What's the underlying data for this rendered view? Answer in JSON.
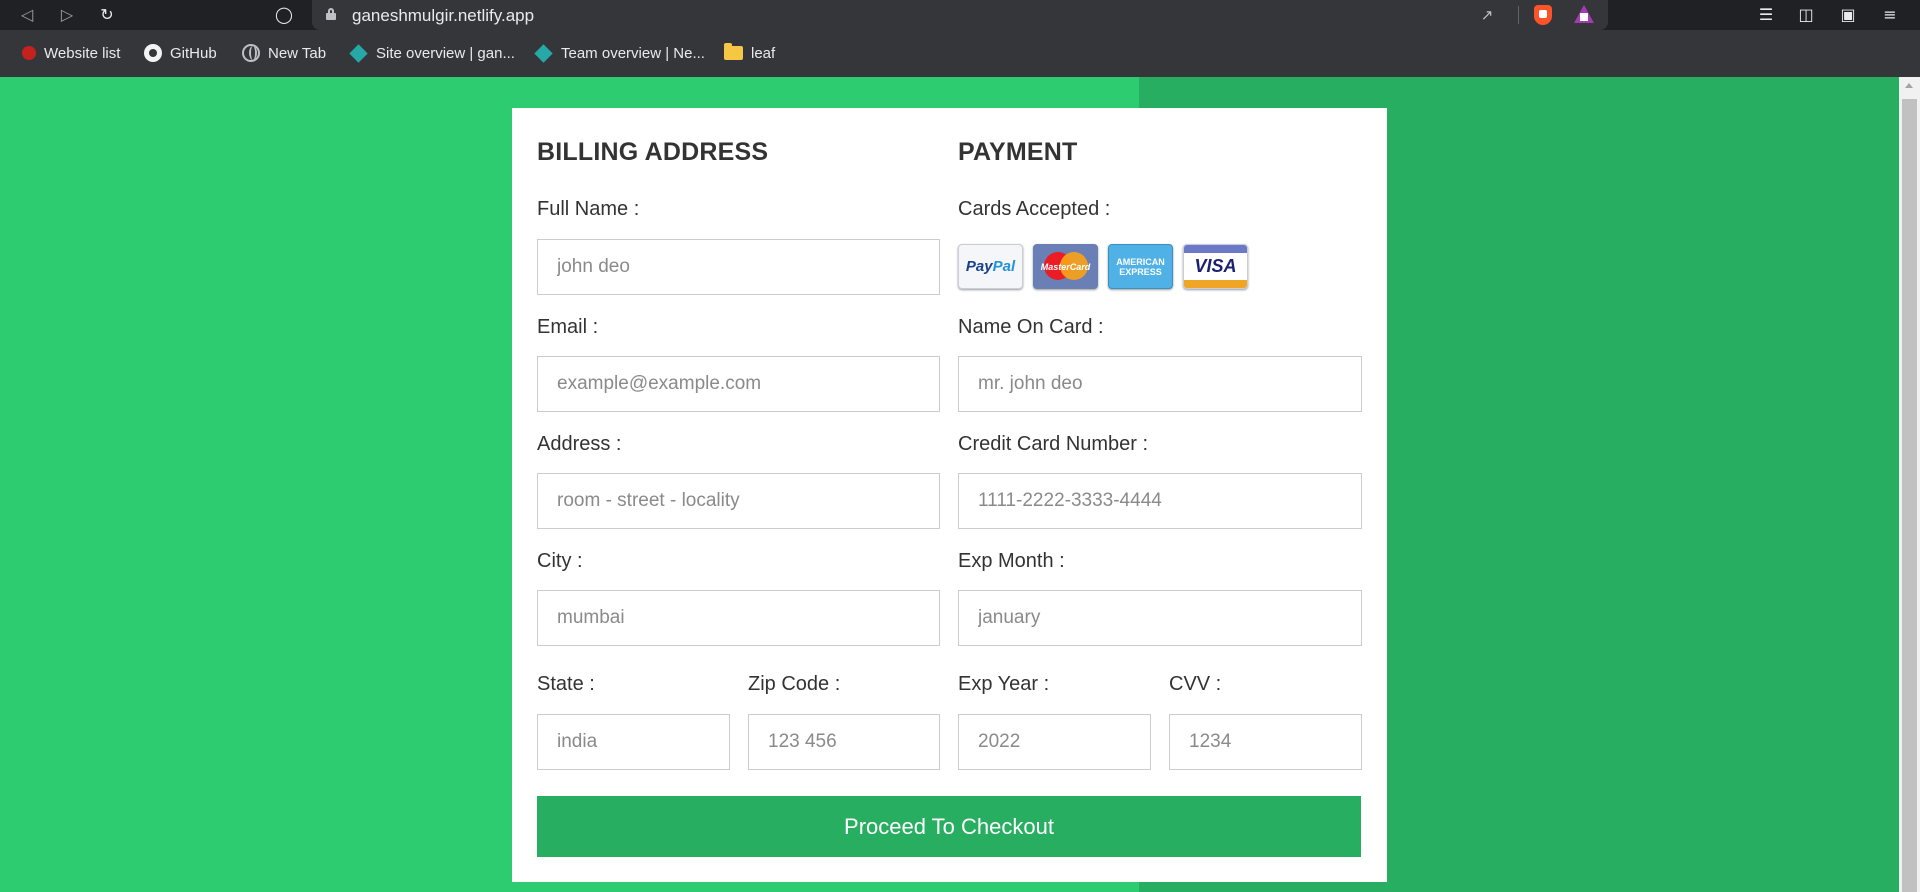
{
  "browser": {
    "url": "ganeshmulgir.netlify.app",
    "bookmarks": [
      {
        "label": "Website list",
        "icon": "red-circle-icon"
      },
      {
        "label": "GitHub",
        "icon": "github-icon"
      },
      {
        "label": "New Tab",
        "icon": "globe-icon"
      },
      {
        "label": "Site overview | gan...",
        "icon": "netlify-icon"
      },
      {
        "label": "Team overview | Ne...",
        "icon": "netlify-icon"
      },
      {
        "label": "leaf",
        "icon": "folder-icon"
      }
    ]
  },
  "billing": {
    "title": "BILLING ADDRESS",
    "full_name": {
      "label": "Full Name :",
      "placeholder": "john deo"
    },
    "email": {
      "label": "Email :",
      "placeholder": "example@example.com"
    },
    "address": {
      "label": "Address :",
      "placeholder": "room - street - locality"
    },
    "city": {
      "label": "City :",
      "placeholder": "mumbai"
    },
    "state": {
      "label": "State :",
      "placeholder": "india"
    },
    "zip": {
      "label": "Zip Code :",
      "placeholder": "123 456"
    }
  },
  "payment": {
    "title": "PAYMENT",
    "cards_label": "Cards Accepted :",
    "cards": {
      "paypal_a": "Pay",
      "paypal_b": "Pal",
      "mastercard": "MasterCard",
      "amex_1": "AMERICAN",
      "amex_2": "EXPRESS",
      "visa": "VISA"
    },
    "name_on_card": {
      "label": "Name On Card :",
      "placeholder": "mr. john deo"
    },
    "card_number": {
      "label": "Credit Card Number :",
      "placeholder": "1111-2222-3333-4444"
    },
    "exp_month": {
      "label": "Exp Month :",
      "placeholder": "january"
    },
    "exp_year": {
      "label": "Exp Year :",
      "placeholder": "2022"
    },
    "cvv": {
      "label": "CVV :",
      "placeholder": "1234"
    }
  },
  "checkout_label": "Proceed To Checkout",
  "colors": {
    "page_bg": "#2ecc71",
    "page_bg_right": "#27ae60",
    "button_bg": "#27ae60",
    "card_bg": "#ffffff"
  }
}
